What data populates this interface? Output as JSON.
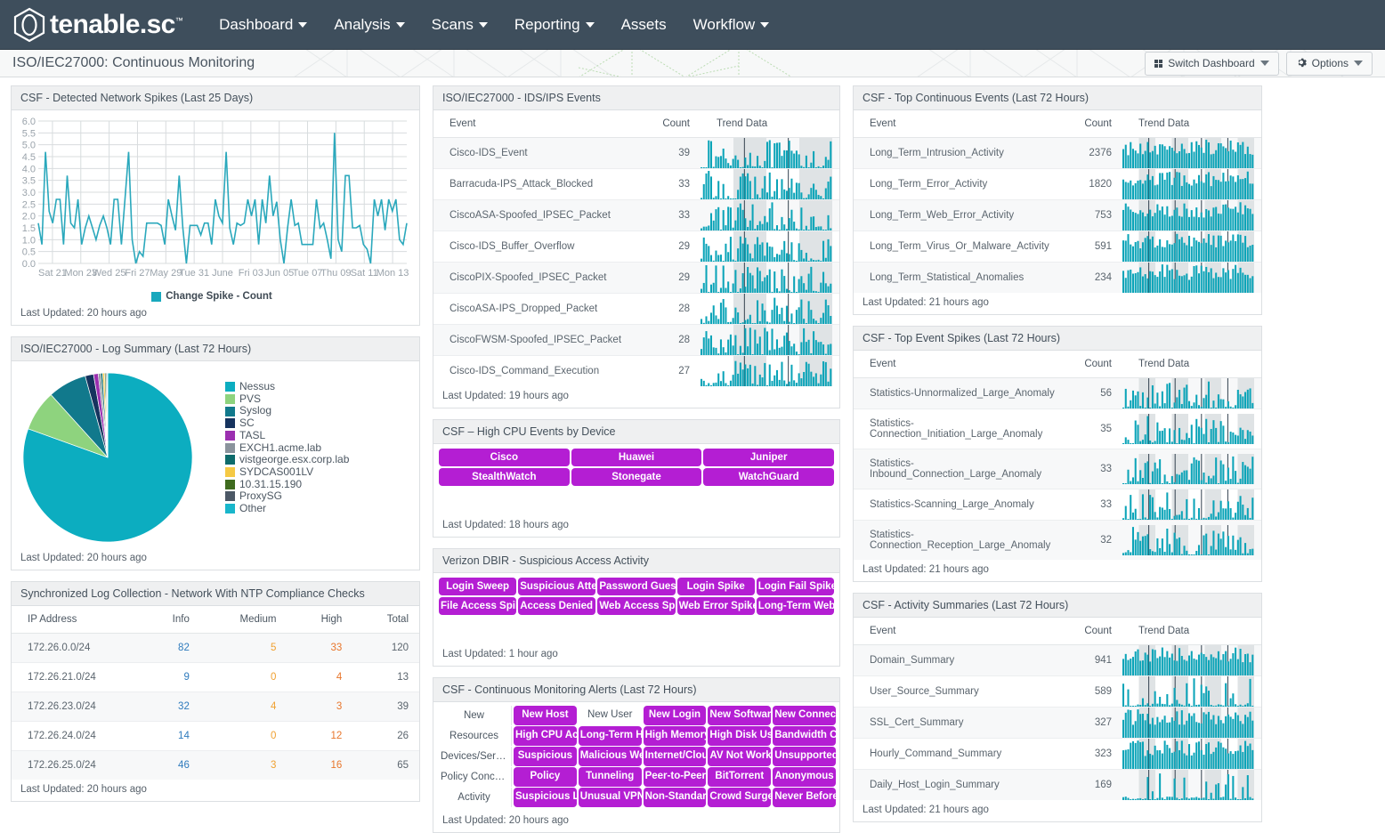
{
  "nav": {
    "brand": "tenable.sc",
    "brand_tm": "™",
    "items": [
      {
        "label": "Dashboard",
        "caret": true
      },
      {
        "label": "Analysis",
        "caret": true
      },
      {
        "label": "Scans",
        "caret": true
      },
      {
        "label": "Reporting",
        "caret": true
      },
      {
        "label": "Assets",
        "caret": false
      },
      {
        "label": "Workflow",
        "caret": true
      }
    ]
  },
  "crumb": {
    "title": "ISO/IEC27000: Continuous Monitoring",
    "switch_dashboard": "Switch Dashboard",
    "options": "Options"
  },
  "colors": {
    "teal": "#0ba4b8",
    "teal_line": "#2aa8bc",
    "purple": "#b41ed3",
    "navy": "#3e4e5c",
    "link": "#2f7bbd",
    "medium": "#f0a030",
    "high": "#e8762c"
  },
  "panels": {
    "network_spikes": {
      "title": "CSF - Detected Network Spikes (Last 25 Days)",
      "updated": "Last Updated: 20 hours ago"
    },
    "log_summary": {
      "title": "ISO/IEC27000 - Log Summary (Last 72 Hours)",
      "updated": "Last Updated: 20 hours ago"
    },
    "ntp_compliance": {
      "title": "Synchronized Log Collection - Network With NTP Compliance Checks",
      "updated": "Last Updated: 20 hours ago",
      "headers": [
        "IP Address",
        "Info",
        "Medium",
        "High",
        "Total"
      ],
      "rows": [
        {
          "ip": "172.26.0.0/24",
          "info": "82",
          "medium": "5",
          "high": "33",
          "total": "120"
        },
        {
          "ip": "172.26.21.0/24",
          "info": "9",
          "medium": "0",
          "high": "4",
          "total": "13"
        },
        {
          "ip": "172.26.23.0/24",
          "info": "32",
          "medium": "4",
          "high": "3",
          "total": "39"
        },
        {
          "ip": "172.26.24.0/24",
          "info": "14",
          "medium": "0",
          "high": "12",
          "total": "26"
        },
        {
          "ip": "172.26.25.0/24",
          "info": "46",
          "medium": "3",
          "high": "16",
          "total": "65"
        }
      ]
    },
    "ids_ips": {
      "title": "ISO/IEC27000 - IDS/IPS Events",
      "updated": "Last Updated: 19 hours ago",
      "headers": [
        "Event",
        "Count",
        "Trend Data"
      ],
      "rows": [
        {
          "event": "Cisco-IDS_Event",
          "count": "39"
        },
        {
          "event": "Barracuda-IPS_Attack_Blocked",
          "count": "33"
        },
        {
          "event": "CiscoASA-Spoofed_IPSEC_Packet",
          "count": "33"
        },
        {
          "event": "Cisco-IDS_Buffer_Overflow",
          "count": "29"
        },
        {
          "event": "CiscoPIX-Spoofed_IPSEC_Packet",
          "count": "29"
        },
        {
          "event": "CiscoASA-IPS_Dropped_Packet",
          "count": "28"
        },
        {
          "event": "CiscoFWSM-Spoofed_IPSEC_Packet",
          "count": "28"
        },
        {
          "event": "Cisco-IDS_Command_Execution",
          "count": "27"
        }
      ]
    },
    "high_cpu": {
      "title": "CSF – High CPU Events by Device",
      "updated": "Last Updated: 18 hours ago",
      "badges": [
        "Cisco",
        "Huawei",
        "Juniper",
        "StealthWatch",
        "Stonegate",
        "WatchGuard"
      ]
    },
    "dbir": {
      "title": "Verizon DBIR - Suspicious Access Activity",
      "updated": "Last Updated: 1 hour ago",
      "badges": [
        "Login Sweep",
        "Suspicious Attempts",
        "Password Guess",
        "Login Spike",
        "Login Fail Spike",
        "File Access Spike",
        "Access Denied Spike",
        "Web Access Spike",
        "Web Error Spike",
        "Long-Term Web Error"
      ]
    },
    "cm_alerts": {
      "title": "CSF - Continuous Monitoring Alerts (Last 72 Hours)",
      "updated": "Last Updated: 20 hours ago",
      "rows": [
        {
          "label": "New",
          "cells": [
            {
              "text": "New Host",
              "filled": true
            },
            {
              "text": "New User",
              "filled": false
            },
            {
              "text": "New Login",
              "filled": true
            },
            {
              "text": "New Software",
              "filled": true
            },
            {
              "text": "New Connection",
              "filled": true
            }
          ]
        },
        {
          "label": "Resources",
          "cells": [
            {
              "text": "High CPU Activity",
              "filled": true
            },
            {
              "text": "Long-Term High CPU",
              "filled": true
            },
            {
              "text": "High Memory Usage",
              "filled": true
            },
            {
              "text": "High Disk Usage",
              "filled": true
            },
            {
              "text": "Bandwidth Consumption",
              "filled": true
            }
          ]
        },
        {
          "label": "Devices/Servi...",
          "cells": [
            {
              "text": "Suspicious",
              "filled": true
            },
            {
              "text": "Malicious Web",
              "filled": true
            },
            {
              "text": "Internet/Cloud",
              "filled": true
            },
            {
              "text": "AV Not Working",
              "filled": true
            },
            {
              "text": "Unsupported",
              "filled": true
            }
          ]
        },
        {
          "label": "Policy Concer...",
          "cells": [
            {
              "text": "Policy",
              "filled": true
            },
            {
              "text": "Tunneling",
              "filled": true
            },
            {
              "text": "Peer-to-Peer",
              "filled": true
            },
            {
              "text": "BitTorrent",
              "filled": true
            },
            {
              "text": "Anonymous FTP",
              "filled": true
            }
          ]
        },
        {
          "label": "Activity",
          "cells": [
            {
              "text": "Suspicious Login",
              "filled": true
            },
            {
              "text": "Unusual VPN",
              "filled": true
            },
            {
              "text": "Non-Standard Type",
              "filled": true
            },
            {
              "text": "Crowd Surge",
              "filled": true
            },
            {
              "text": "Never Before Seen",
              "filled": true
            }
          ]
        }
      ]
    },
    "top_continuous": {
      "title": "CSF - Top Continuous Events (Last 72 Hours)",
      "updated": "Last Updated: 21 hours ago",
      "headers": [
        "Event",
        "Count",
        "Trend Data"
      ],
      "rows": [
        {
          "event": "Long_Term_Intrusion_Activity",
          "count": "2376"
        },
        {
          "event": "Long_Term_Error_Activity",
          "count": "1820"
        },
        {
          "event": "Long_Term_Web_Error_Activity",
          "count": "753"
        },
        {
          "event": "Long_Term_Virus_Or_Malware_Activity",
          "count": "591"
        },
        {
          "event": "Long_Term_Statistical_Anomalies",
          "count": "234"
        }
      ]
    },
    "top_spikes": {
      "title": "CSF - Top Event Spikes (Last 72 Hours)",
      "updated": "Last Updated: 21 hours ago",
      "headers": [
        "Event",
        "Count",
        "Trend Data"
      ],
      "rows": [
        {
          "event": "Statistics-Unnormalized_Large_Anomaly",
          "count": "56"
        },
        {
          "event": "Statistics-Connection_Initiation_Large_Anomaly",
          "count": "35"
        },
        {
          "event": "Statistics-Inbound_Connection_Large_Anomaly",
          "count": "33"
        },
        {
          "event": "Statistics-Scanning_Large_Anomaly",
          "count": "33"
        },
        {
          "event": "Statistics-Connection_Reception_Large_Anomaly",
          "count": "32"
        }
      ]
    },
    "activity_summaries": {
      "title": "CSF - Activity Summaries (Last 72 Hours)",
      "updated": "Last Updated: 21 hours ago",
      "headers": [
        "Event",
        "Count",
        "Trend Data"
      ],
      "rows": [
        {
          "event": "Domain_Summary",
          "count": "941"
        },
        {
          "event": "User_Source_Summary",
          "count": "589"
        },
        {
          "event": "SSL_Cert_Summary",
          "count": "327"
        },
        {
          "event": "Hourly_Command_Summary",
          "count": "323"
        },
        {
          "event": "Daily_Host_Login_Summary",
          "count": "169"
        }
      ]
    }
  },
  "chart_data": [
    {
      "type": "line",
      "id": "network_spikes",
      "title": "CSF - Detected Network Spikes (Last 25 Days)",
      "xlabel": "",
      "ylabel": "",
      "ylim": [
        0,
        6
      ],
      "yticks": [
        "0.0",
        "0.5",
        "1.0",
        "1.5",
        "2.0",
        "2.5",
        "3.0",
        "3.5",
        "4.0",
        "4.5",
        "5.0",
        "5.5",
        "6.0"
      ],
      "grid": true,
      "legend": [
        "Change Spike - Count"
      ],
      "legend_position": "bottom",
      "xticks": [
        "Sat 21",
        "Mon 23",
        "Wed 25",
        "Fri 27",
        "May 29",
        "Tue 31",
        "June",
        "Fri 03",
        "Jun 05",
        "Tue 07",
        "Thu 09",
        "Sat 11",
        "Mon 13"
      ],
      "series": [
        {
          "name": "Change Spike - Count",
          "color": "#2aa8bc",
          "values": [
            1.7,
            0.8,
            4.7,
            2.2,
            1.7,
            2.7,
            2.7,
            0.8,
            3.7,
            1.7,
            1.5,
            2.7,
            0.8,
            1.5,
            2.0,
            1.5,
            1.0,
            1.6,
            2.0,
            1.5,
            0.8,
            2.7,
            2.7,
            0.8,
            2.7,
            4.7,
            1.0,
            0.0,
            0.5,
            0.3,
            1.7,
            1.7,
            1.7,
            1.7,
            1.6,
            0.8,
            2.7,
            2.0,
            1.4,
            3.7,
            1.5,
            0.0,
            1.6,
            1.6,
            1.6,
            1.2,
            1.7,
            1.7,
            0.8,
            2.7,
            2.0,
            1.7,
            4.7,
            1.5,
            0.8,
            1.7,
            1.6,
            1.7,
            2.7,
            2.0,
            2.7,
            0.8,
            2.7,
            1.7,
            3.7,
            2.0,
            2.6,
            1.0,
            0.0,
            1.5,
            2.7,
            1.6,
            1.7,
            0.8,
            0.8,
            0.8,
            0.8,
            2.7,
            1.5,
            1.7,
            1.0,
            0.2,
            5.5,
            1.0,
            0.5,
            3.7,
            3.7,
            1.5,
            1.5,
            1.6,
            0.8,
            0.6,
            0.0,
            2.7,
            2.0,
            2.7,
            1.4,
            2.7,
            2.2,
            2.7,
            1.0,
            0.8,
            1.7
          ]
        }
      ]
    },
    {
      "type": "pie",
      "id": "log_summary",
      "title": "ISO/IEC27000 - Log Summary (Last 72 Hours)",
      "legend_position": "right",
      "labels": [
        "Nessus",
        "PVS",
        "Syslog",
        "SC",
        "TASL",
        "EXCH1.acme.lab",
        "vistgeorge.esx.corp.lab",
        "SYDCAS001LV",
        "10.31.15.190",
        "ProxySG",
        "Other"
      ],
      "colors": [
        "#0cadc0",
        "#8ed37e",
        "#11798c",
        "#16335e",
        "#9b2fb0",
        "#8a939c",
        "#0e6b6b",
        "#f5c944",
        "#3f6b1f",
        "#4c5866",
        "#19b6cb"
      ],
      "values": [
        80.5,
        7.8,
        7.4,
        1.6,
        0.9,
        0.45,
        0.4,
        0.35,
        0.25,
        0.2,
        0.15
      ]
    }
  ]
}
